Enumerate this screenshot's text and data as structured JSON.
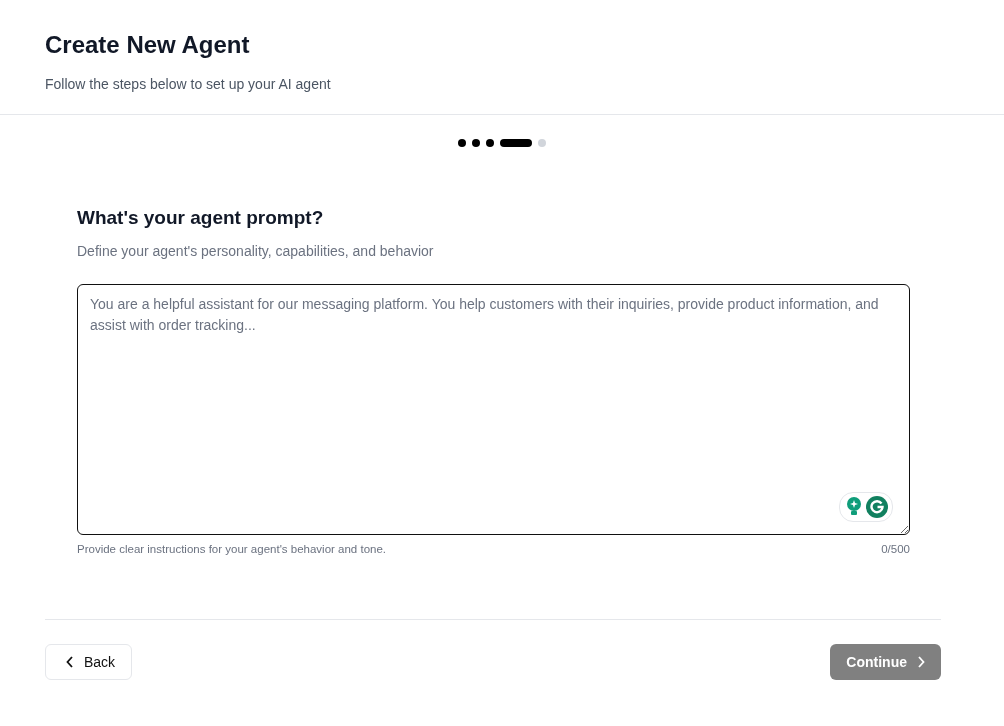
{
  "header": {
    "title": "Create New Agent",
    "subtitle": "Follow the steps below to set up your AI agent"
  },
  "steps": [
    {
      "kind": "done"
    },
    {
      "kind": "done"
    },
    {
      "kind": "done"
    },
    {
      "kind": "current"
    },
    {
      "kind": "upcoming"
    }
  ],
  "question": {
    "title": "What's your agent prompt?",
    "description": "Define your agent's personality, capabilities, and behavior"
  },
  "prompt_field": {
    "placeholder": "You are a helpful assistant for our messaging platform. You help customers with their inquiries, provide product information, and assist with order tracking...",
    "hint": "Provide clear instructions for your agent's behavior and tone.",
    "counter": "0/500"
  },
  "footer": {
    "back": {
      "label": "Back"
    },
    "continue": {
      "label": "Continue",
      "disabled": true
    }
  }
}
